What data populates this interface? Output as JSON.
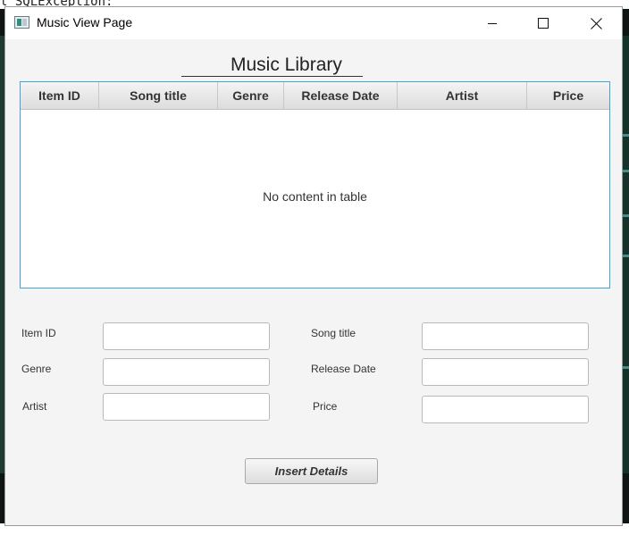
{
  "background": {
    "console_text": "l SQLException:"
  },
  "window": {
    "title": "Music View Page",
    "icon": "app-window-icon"
  },
  "page": {
    "title": "Music Library"
  },
  "table": {
    "columns": [
      "Item ID",
      "Song title",
      "Genre",
      "Release Date",
      "Artist",
      "Price"
    ],
    "empty_message": "No content in table",
    "rows": []
  },
  "form": {
    "item_id_label": "Item ID",
    "item_id_value": "",
    "song_title_label": "Song title",
    "song_title_value": "",
    "genre_label": "Genre",
    "genre_value": "",
    "release_date_label": "Release Date",
    "release_date_value": "",
    "artist_label": "Artist",
    "artist_value": "",
    "price_label": "Price",
    "price_value": ""
  },
  "actions": {
    "insert_label": "Insert Details"
  },
  "colors": {
    "table_border": "#3fa3d6",
    "window_bg": "#f4f4f4"
  }
}
